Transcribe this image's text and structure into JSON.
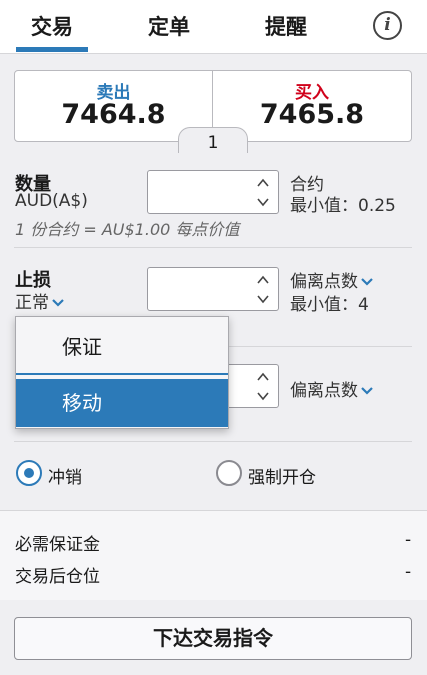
{
  "tabs": [
    {
      "label": "交易",
      "active": true
    },
    {
      "label": "定单",
      "active": false
    },
    {
      "label": "提醒",
      "active": false
    }
  ],
  "info_icon": "info-icon",
  "prices": {
    "sell_label": "卖出",
    "sell_value": "7464.8",
    "buy_label": "买入",
    "buy_value": "7465.8",
    "spread": "1",
    "sell_color": "#2c7ab8",
    "buy_color": "#d0021b"
  },
  "quantity": {
    "label": "数量",
    "currency": "AUD(A$)",
    "value": "",
    "unit": "合约",
    "min": "最小值：0.25",
    "note": "1 份合约 = AU$1.00 每点价值"
  },
  "stop": {
    "label": "止损",
    "type": "正常",
    "value": "",
    "unit": "偏离点数",
    "min": "最小值：4"
  },
  "limit": {
    "value": "",
    "unit": "偏离点数"
  },
  "dropdown": {
    "options": [
      "保证",
      "移动"
    ],
    "selected_index": 1,
    "highlight_color": "#2c7ab8"
  },
  "position_mode": {
    "options": [
      {
        "label": "冲销",
        "checked": true
      },
      {
        "label": "强制开仓",
        "checked": false
      }
    ]
  },
  "summary": {
    "margin_label": "必需保证金",
    "margin_value": "-",
    "position_label": "交易后仓位",
    "position_value": "-"
  },
  "submit_label": "下达交易指令",
  "accent_color": "#2c7ab8"
}
